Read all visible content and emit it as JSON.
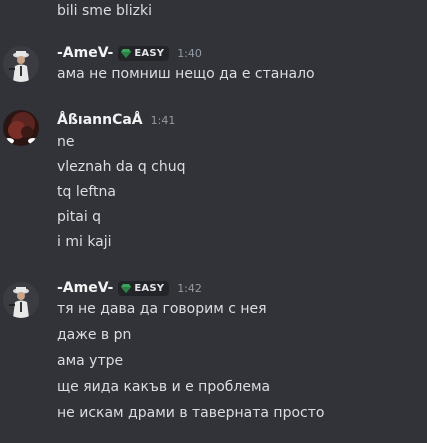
{
  "messages": {
    "prev_line": "bili sme blizki",
    "group1": {
      "username": "-AmeV-",
      "tag": "EASY",
      "time": "1:40",
      "lines": [
        "ама не помниш нещо да е станало"
      ]
    },
    "group2": {
      "username": "ÅßıannCaÅ",
      "time": "1:41",
      "lines": [
        "ne",
        "vleznah da q chuq",
        "tq leftna",
        "pitai q",
        "i mi kaji"
      ]
    },
    "group3": {
      "username": "-AmeV-",
      "tag": "EASY",
      "time": "1:42",
      "lines": [
        "тя не дава да говорим с нея",
        "даже в pn",
        "ама утре",
        "ще яида какъв и е проблема",
        "не искам драми в таверната просто"
      ]
    }
  },
  "colors": {
    "background": "#313338",
    "text": "#dbdee1",
    "username": "#f2f3f5",
    "timestamp": "#949ba4",
    "tag_bg": "#232428",
    "gem": "#3ba55c"
  },
  "icons": {
    "tag_icon": "gem-icon",
    "avatar1": "avatar-icon",
    "avatar2": "avatar-icon"
  }
}
